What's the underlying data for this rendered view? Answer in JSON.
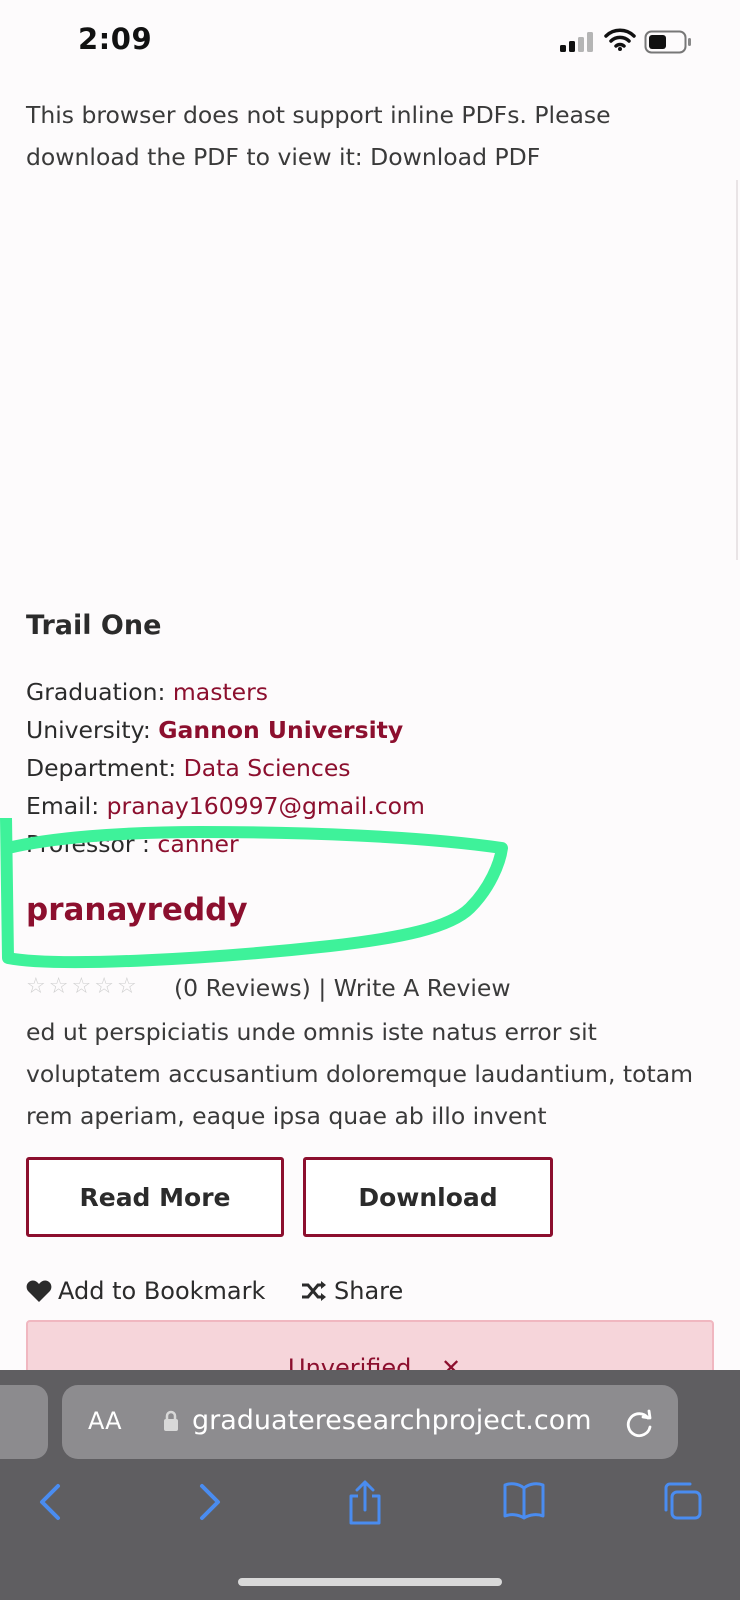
{
  "status_bar": {
    "time": "2:09"
  },
  "pdf_notice": "This browser does not support inline PDFs. Please download the PDF to view it: Download PDF",
  "project": {
    "title": "Trail One",
    "graduation": {
      "label": "Graduation:",
      "value": "masters"
    },
    "university": {
      "label": "University:",
      "value": "Gannon University"
    },
    "department": {
      "label": "Department:",
      "value": "Data Sciences"
    },
    "email": {
      "label": "Email:",
      "value": "pranay160997@gmail.com"
    },
    "professor": {
      "label": "Professor :",
      "value": "canner"
    },
    "username": "pranayreddy",
    "rating": {
      "stars_filled": 0,
      "stars_total": 5,
      "reviews_text": "(0 Reviews) | Write A Review"
    },
    "description": "ed ut perspiciatis unde omnis iste natus error sit voluptatem accusantium doloremque laudantium, totam rem aperiam, eaque ipsa quae ab illo invent",
    "buttons": {
      "read_more": "Read More",
      "download": "Download"
    },
    "actions": {
      "bookmark": "Add to Bookmark",
      "share": "Share"
    },
    "status_banner": "Unverified"
  },
  "safari": {
    "text_size": "AA",
    "url": "graduateresearchproject.com"
  },
  "colors": {
    "accent": "#8c0f2e",
    "highlight": "#3ef29a",
    "safari_bar": "#5f5e61",
    "safari_icons": "#4a8cf0"
  }
}
